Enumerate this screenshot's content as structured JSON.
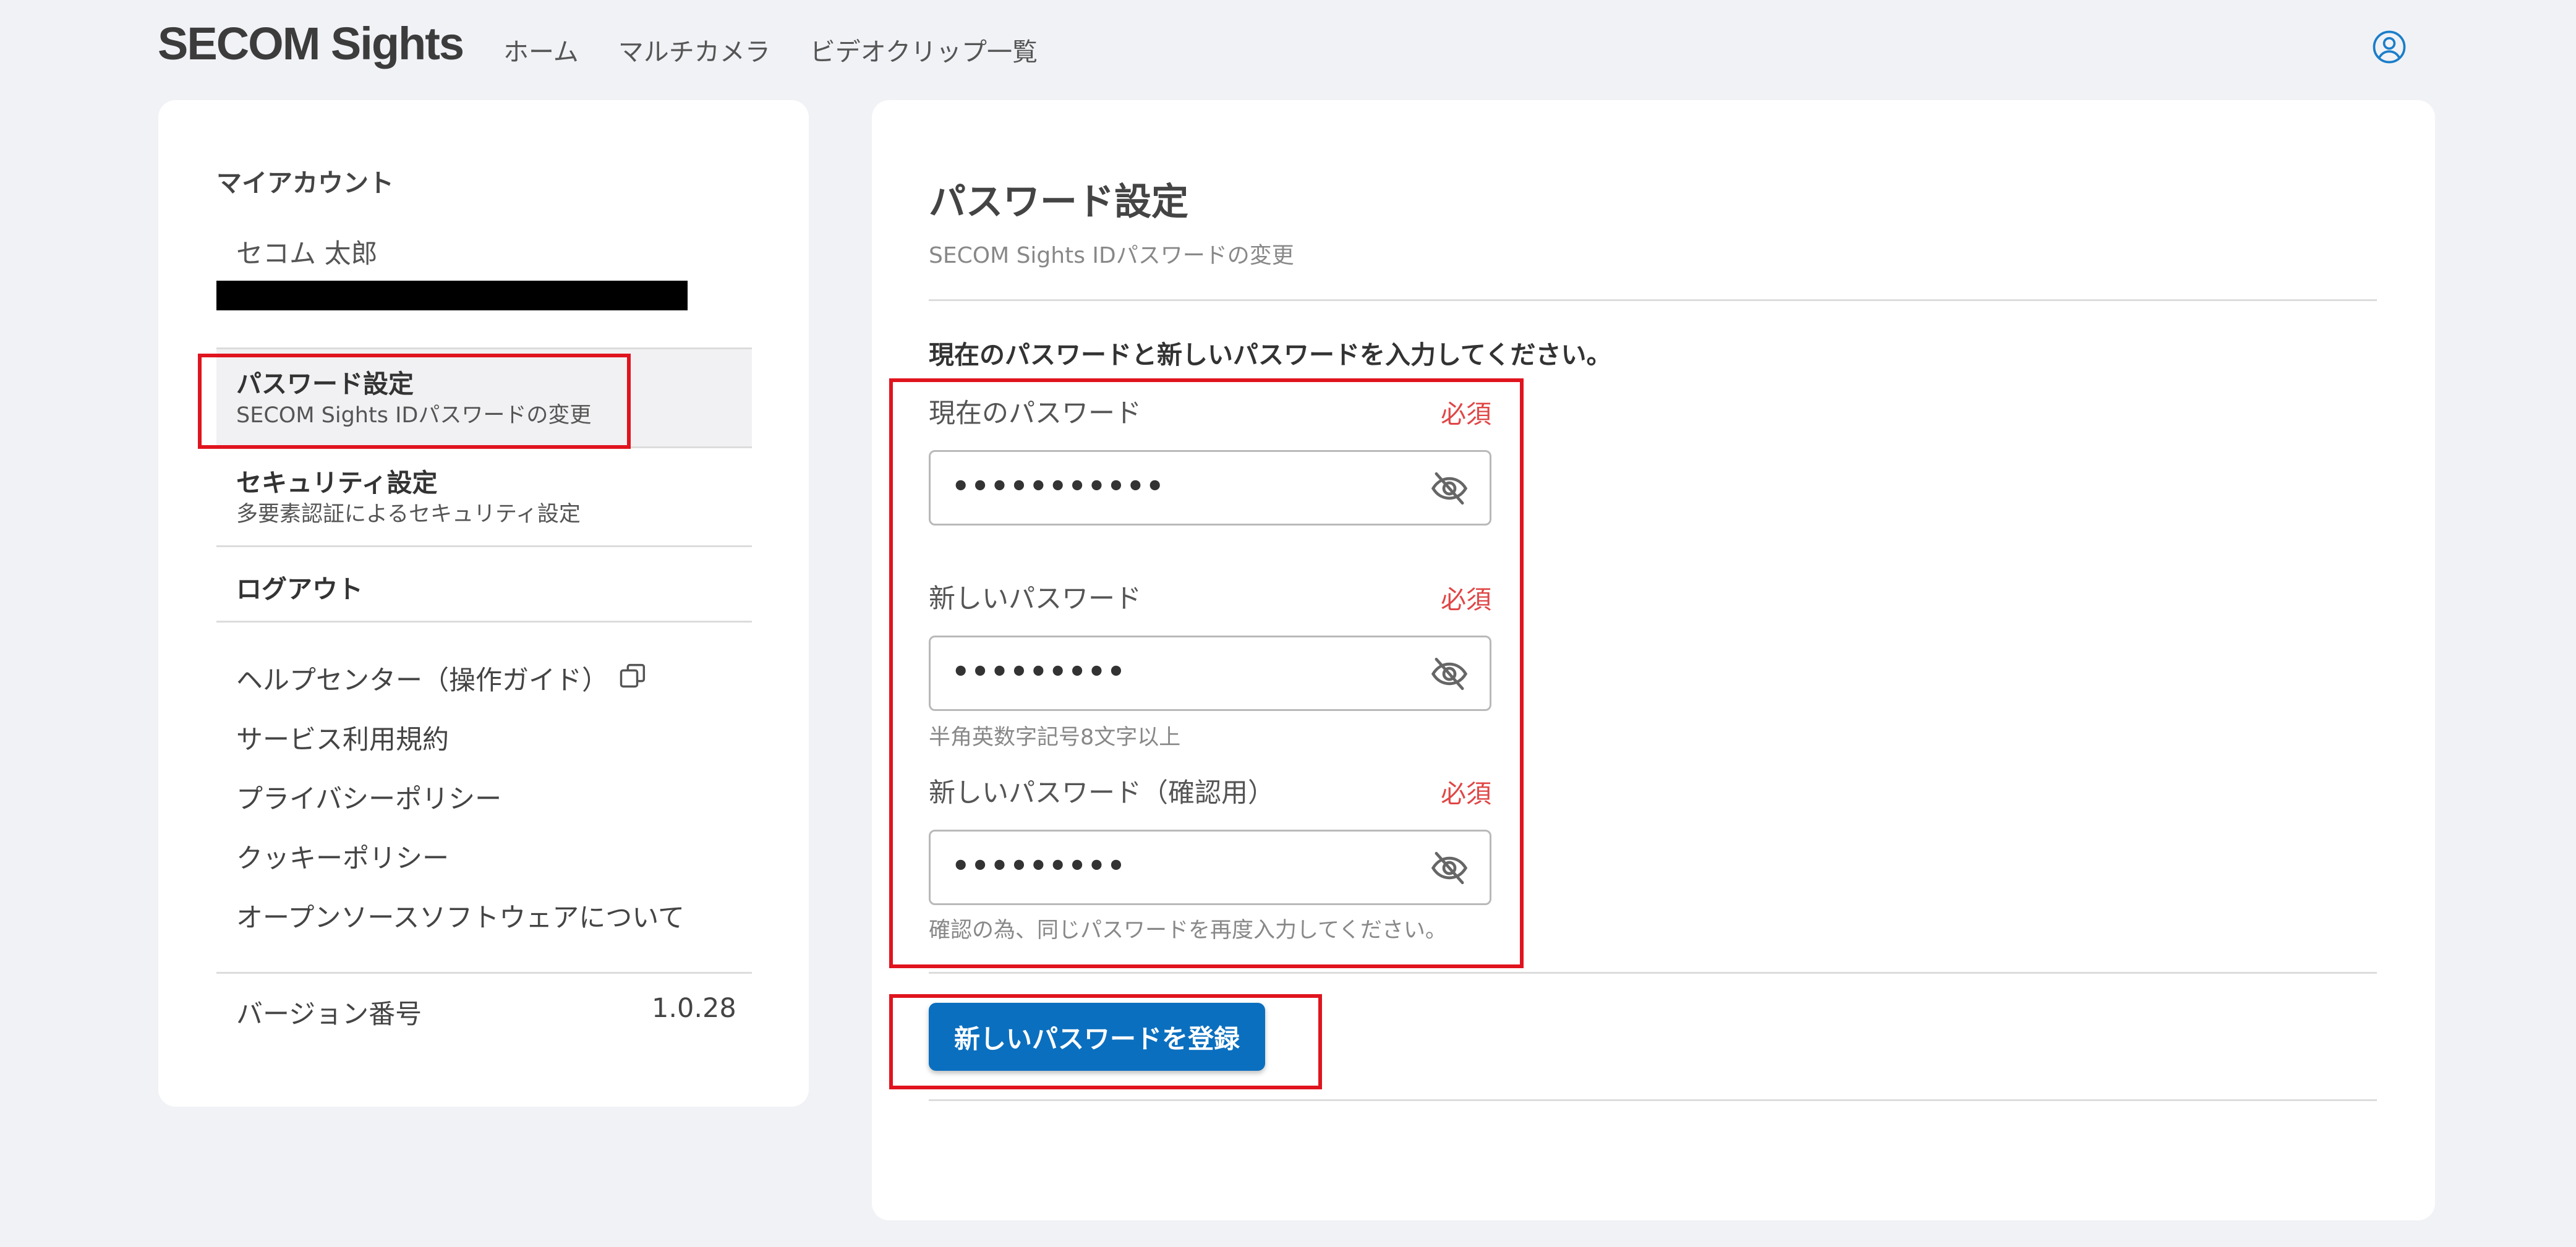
{
  "header": {
    "logo": "SECOM Sights",
    "nav": [
      "ホーム",
      "マルチカメラ",
      "ビデオクリップ一覧"
    ]
  },
  "sidebar": {
    "heading": "マイアカウント",
    "username": "セコム 太郎",
    "menu": [
      {
        "title": "パスワード設定",
        "subtitle": "SECOM Sights IDパスワードの変更"
      },
      {
        "title": "セキュリティ設定",
        "subtitle": "多要素認証によるセキュリティ設定"
      },
      {
        "title": "ログアウト"
      }
    ],
    "links": [
      "ヘルプセンター（操作ガイド）",
      "サービス利用規約",
      "プライバシーポリシー",
      "クッキーポリシー",
      "オープンソースソフトウェアについて"
    ],
    "version_label": "バージョン番号",
    "version_value": "1.0.28"
  },
  "main": {
    "title": "パスワード設定",
    "subtitle": "SECOM Sights IDパスワードの変更",
    "instruction": "現在のパスワードと新しいパスワードを入力してください。",
    "required_label": "必須",
    "fields": [
      {
        "label": "現在のパスワード",
        "value": "•••••••••••"
      },
      {
        "label": "新しいパスワード",
        "value": "•••••••••",
        "hint": "半角英数字記号8文字以上"
      },
      {
        "label": "新しいパスワード（確認用）",
        "value": "•••••••••",
        "hint": "確認の為、同じパスワードを再度入力してください。"
      }
    ],
    "submit_label": "新しいパスワードを登録"
  },
  "colors": {
    "accent": "#0b6fbf",
    "required": "#e04646",
    "annotation": "#e0141e",
    "background": "#f1f2f6"
  }
}
